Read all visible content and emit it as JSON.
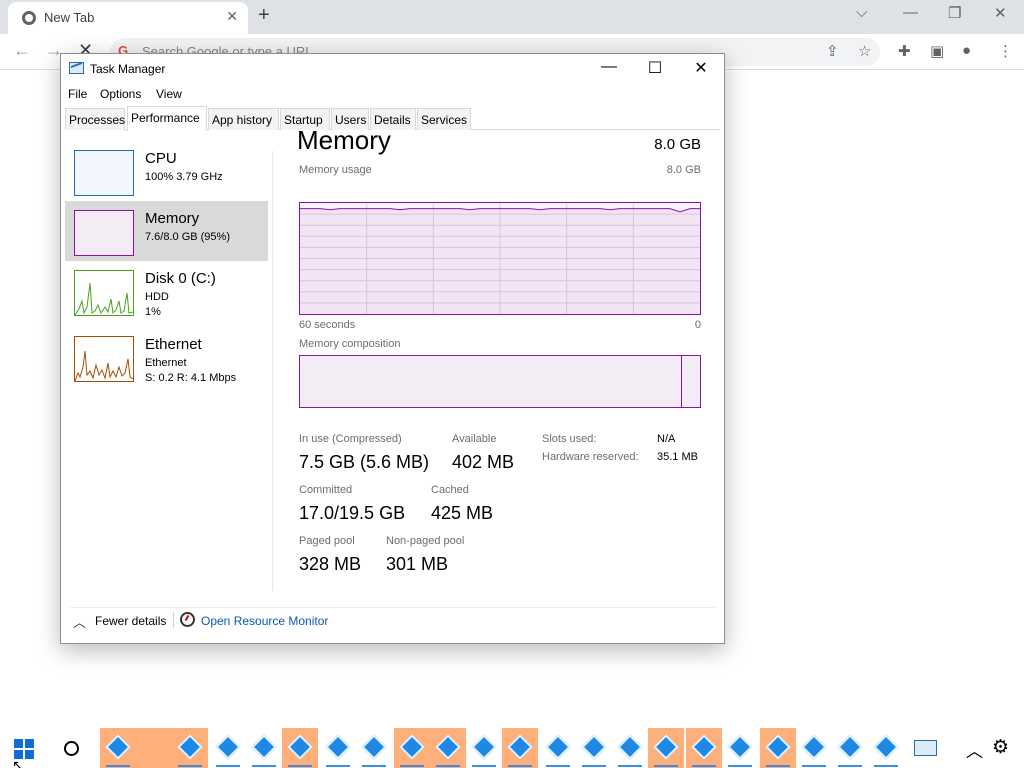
{
  "browser": {
    "tab_title": "New Tab",
    "omnibox_placeholder": "Search Google or type a URL"
  },
  "task_manager": {
    "window_title": "Task Manager",
    "menu": [
      "File",
      "Options",
      "View"
    ],
    "tabs": [
      "Processes",
      "Performance",
      "App history",
      "Startup",
      "Users",
      "Details",
      "Services"
    ],
    "active_tab": "Performance",
    "sidebar": [
      {
        "name": "CPU",
        "line1": "100%  3.79 GHz",
        "line2": "",
        "color": "#1e6fb8"
      },
      {
        "name": "Memory",
        "line1": "7.6/8.0 GB (95%)",
        "line2": "",
        "color": "#8b12ae"
      },
      {
        "name": "Disk 0 (C:)",
        "line1": "HDD",
        "line2": "1%",
        "color": "#4aa11e"
      },
      {
        "name": "Ethernet",
        "line1": "Ethernet",
        "line2": "S: 0.2  R: 4.1 Mbps",
        "color": "#a74f01"
      }
    ],
    "selected_item": "Memory",
    "memory": {
      "title": "Memory",
      "total": "8.0 GB",
      "usage_label": "Memory usage",
      "usage_max": "8.0 GB",
      "axis_left": "60 seconds",
      "axis_right": "0",
      "composition_label": "Memory composition",
      "usage_level_fraction": 0.95,
      "stats": {
        "in_use_label": "In use (Compressed)",
        "in_use_value": "7.5 GB (5.6 MB)",
        "available_label": "Available",
        "available_value": "402 MB",
        "committed_label": "Committed",
        "committed_value": "17.0/19.5 GB",
        "cached_label": "Cached",
        "cached_value": "425 MB",
        "paged_label": "Paged pool",
        "paged_value": "328 MB",
        "nonpaged_label": "Non-paged pool",
        "nonpaged_value": "301 MB",
        "slots_label": "Slots used:",
        "slots_value": "N/A",
        "hw_reserved_label": "Hardware reserved:",
        "hw_reserved_value": "35.1 MB"
      }
    },
    "footer": {
      "fewer_details": "Fewer details",
      "open_resource_monitor": "Open Resource Monitor"
    }
  },
  "colors": {
    "memory_accent": "#8b12ae",
    "taskbar_highlight": "#ffb07a",
    "link": "#0a58b5"
  }
}
